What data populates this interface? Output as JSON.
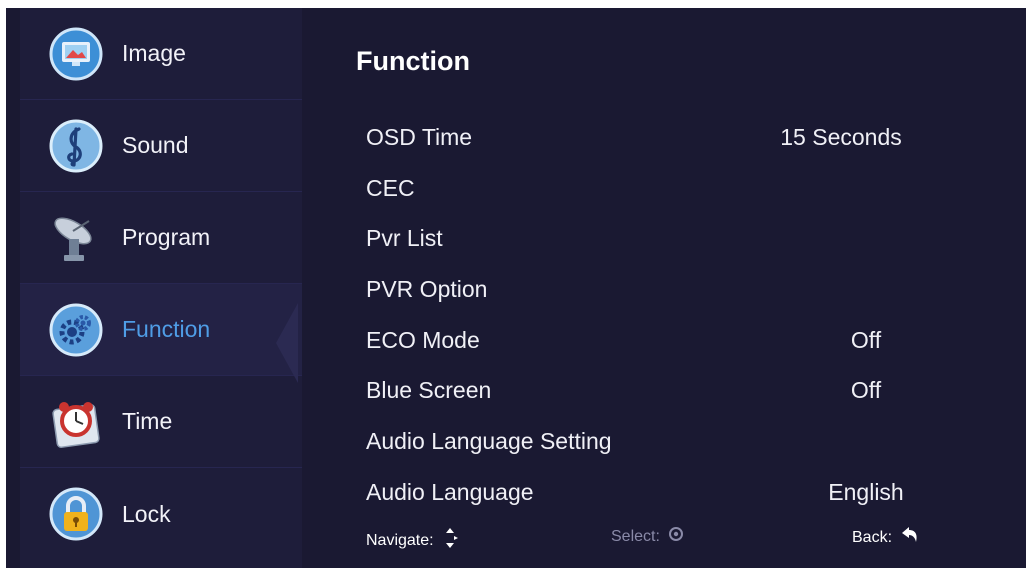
{
  "sidebar": {
    "items": [
      {
        "label": "Image",
        "icon": "image-icon"
      },
      {
        "label": "Sound",
        "icon": "music-note-icon"
      },
      {
        "label": "Program",
        "icon": "satellite-dish-icon"
      },
      {
        "label": "Function",
        "icon": "gear-icon",
        "active": true
      },
      {
        "label": "Time",
        "icon": "alarm-clock-icon"
      },
      {
        "label": "Lock",
        "icon": "padlock-icon"
      }
    ]
  },
  "main": {
    "title": "Function",
    "rows": [
      {
        "name": "OSD Time",
        "value": "15 Seconds"
      },
      {
        "name": "CEC",
        "value": ""
      },
      {
        "name": "Pvr List",
        "value": ""
      },
      {
        "name": "PVR Option",
        "value": ""
      },
      {
        "name": "ECO Mode",
        "value": "Off"
      },
      {
        "name": "Blue Screen",
        "value": "Off"
      },
      {
        "name": "Audio Language Setting",
        "value": ""
      },
      {
        "name": "Audio Language",
        "value": "English"
      }
    ]
  },
  "footer": {
    "navigate": "Navigate:",
    "select": "Select:",
    "back": "Back:"
  },
  "colors": {
    "background": "#1a1932",
    "sidebar": "#1e1d3a",
    "active_label": "#4f9de6",
    "text": "#f0f0f6",
    "hint_dim": "#8a8aa8"
  }
}
